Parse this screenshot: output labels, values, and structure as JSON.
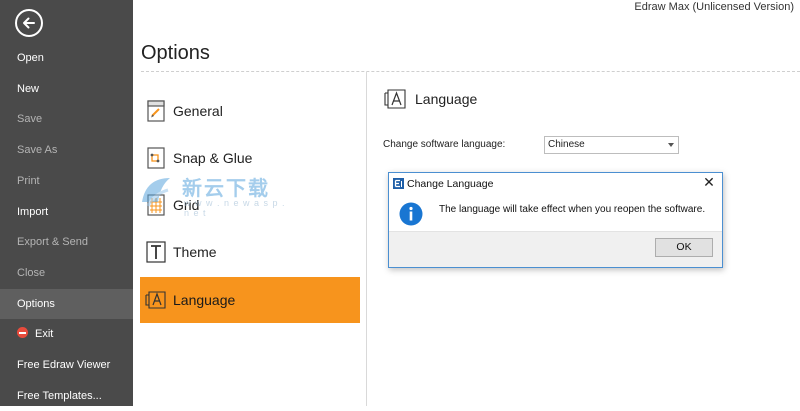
{
  "app": {
    "title": "Edraw Max (Unlicensed Version)"
  },
  "sidebar": {
    "items": [
      {
        "label": "Open",
        "state": "enabled"
      },
      {
        "label": "New",
        "state": "enabled"
      },
      {
        "label": "Save",
        "state": "disabled"
      },
      {
        "label": "Save As",
        "state": "disabled"
      },
      {
        "label": "Print",
        "state": "disabled"
      },
      {
        "label": "Import",
        "state": "enabled"
      },
      {
        "label": "Export & Send",
        "state": "disabled"
      },
      {
        "label": "Close",
        "state": "disabled"
      },
      {
        "label": "Options",
        "state": "selected"
      },
      {
        "label": "Exit",
        "state": "enabled",
        "icon": "exit-icon"
      },
      {
        "label": "Free Edraw Viewer",
        "state": "enabled"
      },
      {
        "label": "Free Templates...",
        "state": "enabled"
      }
    ]
  },
  "page": {
    "title": "Options"
  },
  "categories": [
    {
      "label": "General",
      "icon": "general-icon"
    },
    {
      "label": "Snap & Glue",
      "icon": "snap-glue-icon"
    },
    {
      "label": "Grid",
      "icon": "grid-icon"
    },
    {
      "label": "Theme",
      "icon": "theme-icon"
    },
    {
      "label": "Language",
      "icon": "language-icon",
      "selected": true
    }
  ],
  "language_section": {
    "heading": "Language",
    "change_label": "Change software language:",
    "selected_language": "Chinese"
  },
  "dialog": {
    "title": "Change Language",
    "message": "The language will take effect when you reopen the software.",
    "ok_label": "OK",
    "close_glyph": "✕"
  },
  "watermark": {
    "text": "新云下载",
    "url": "w w w . n e w a s p . n e t"
  },
  "colors": {
    "sidebar_bg": "#4a4a4a",
    "accent": "#f7941d",
    "dialog_border": "#4b8fd1",
    "info_blue": "#1976d2"
  }
}
